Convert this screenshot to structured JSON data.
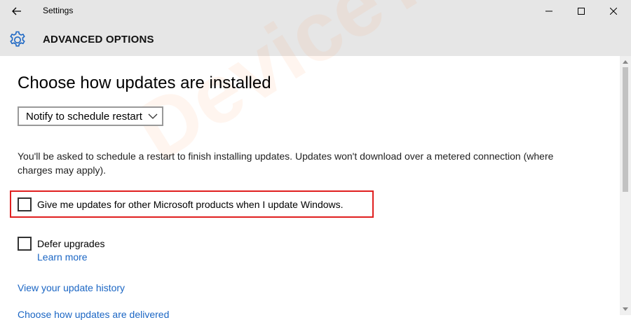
{
  "window": {
    "title": "Settings",
    "back_icon": "back-arrow-icon",
    "controls": [
      "minimize-icon",
      "maximize-icon",
      "close-icon"
    ]
  },
  "header": {
    "title": "ADVANCED OPTIONS",
    "icon": "gear-icon",
    "accent": "#1b66c4"
  },
  "main": {
    "heading": "Choose how updates are installed",
    "dropdown": {
      "selected": "Notify to schedule restart"
    },
    "description": "You'll be asked to schedule a restart to finish installing updates. Updates won't download over a metered connection (where charges may apply).",
    "checkbox_other_products": {
      "label": "Give me updates for other Microsoft products when I update Windows.",
      "checked": false
    },
    "checkbox_defer": {
      "label": "Defer upgrades",
      "checked": false
    },
    "learn_more": "Learn more",
    "history_link": "View your update history",
    "cut_off_link": "Choose how updates are delivered"
  },
  "colors": {
    "highlight": "#e01f1f",
    "link": "#1b66c4",
    "chrome": "#e6e6e6"
  },
  "watermark": "DeviceTricks"
}
